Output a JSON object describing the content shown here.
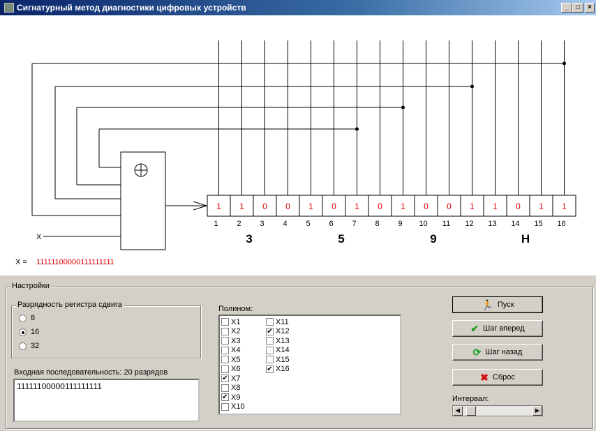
{
  "window": {
    "title": "Сигнатурный метод диагностики цифровых устройств",
    "minimize": "_",
    "maximize": "□",
    "close": "×"
  },
  "diagram": {
    "register_cells": [
      "1",
      "1",
      "0",
      "0",
      "1",
      "0",
      "1",
      "0",
      "1",
      "0",
      "0",
      "1",
      "1",
      "0",
      "1",
      "1"
    ],
    "register_indices": [
      "1",
      "2",
      "3",
      "4",
      "5",
      "6",
      "7",
      "8",
      "9",
      "10",
      "11",
      "12",
      "13",
      "14",
      "15",
      "16"
    ],
    "feedback_taps": [
      7,
      9,
      12,
      16
    ],
    "hex_digits": [
      "3",
      "5",
      "9",
      "H"
    ],
    "xor_symbol": "⊕",
    "input_label": "X",
    "sequence_label": "X =",
    "sequence_value": "11111100000111111111"
  },
  "settings": {
    "legend": "Настройки",
    "register_width": {
      "legend": "Разрядность регистра сдвига",
      "options": [
        "8",
        "16",
        "32"
      ],
      "selected": "16"
    },
    "input_sequence": {
      "label": "Входная последовательность: 20 разрядов",
      "value": "11111100000111111111"
    },
    "polynomial": {
      "label": "Полином:",
      "items": [
        {
          "label": "X1",
          "checked": false
        },
        {
          "label": "X2",
          "checked": false
        },
        {
          "label": "X3",
          "checked": false
        },
        {
          "label": "X4",
          "checked": false
        },
        {
          "label": "X5",
          "checked": false
        },
        {
          "label": "X6",
          "checked": false
        },
        {
          "label": "X7",
          "checked": true
        },
        {
          "label": "X8",
          "checked": false
        },
        {
          "label": "X9",
          "checked": true
        },
        {
          "label": "X10",
          "checked": false
        },
        {
          "label": "X11",
          "checked": false
        },
        {
          "label": "X12",
          "checked": true
        },
        {
          "label": "X13",
          "checked": false
        },
        {
          "label": "X14",
          "checked": false
        },
        {
          "label": "X15",
          "checked": false
        },
        {
          "label": "X16",
          "checked": true
        }
      ]
    },
    "buttons": {
      "start": "Пуск",
      "step_forward": "Шаг вперед",
      "step_back": "Шаг назад",
      "reset": "Сброс"
    },
    "interval_label": "Интервал:",
    "interval_value": 0.05
  },
  "colors": {
    "cell_text": "#e00000",
    "sequence_text": "#e00000",
    "check_icon": "#1a9a1a",
    "reset_icon": "#d01010",
    "back_icon": "#10a020",
    "start_icon": "#1a9a1a"
  }
}
